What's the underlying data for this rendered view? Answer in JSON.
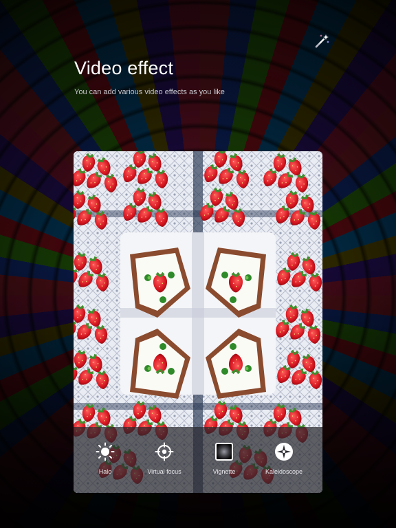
{
  "header": {
    "title": "Video effect",
    "subtitle": "You can add various video effects as you like"
  },
  "effects": [
    {
      "label": "Halo",
      "icon": "sun-icon"
    },
    {
      "label": "Virtual focus",
      "icon": "target-icon"
    },
    {
      "label": "Vignette",
      "icon": "vignette-icon"
    },
    {
      "label": "Kaleidoscope",
      "icon": "kaleidoscope-icon"
    }
  ],
  "top_icon": "magic-wand-icon"
}
